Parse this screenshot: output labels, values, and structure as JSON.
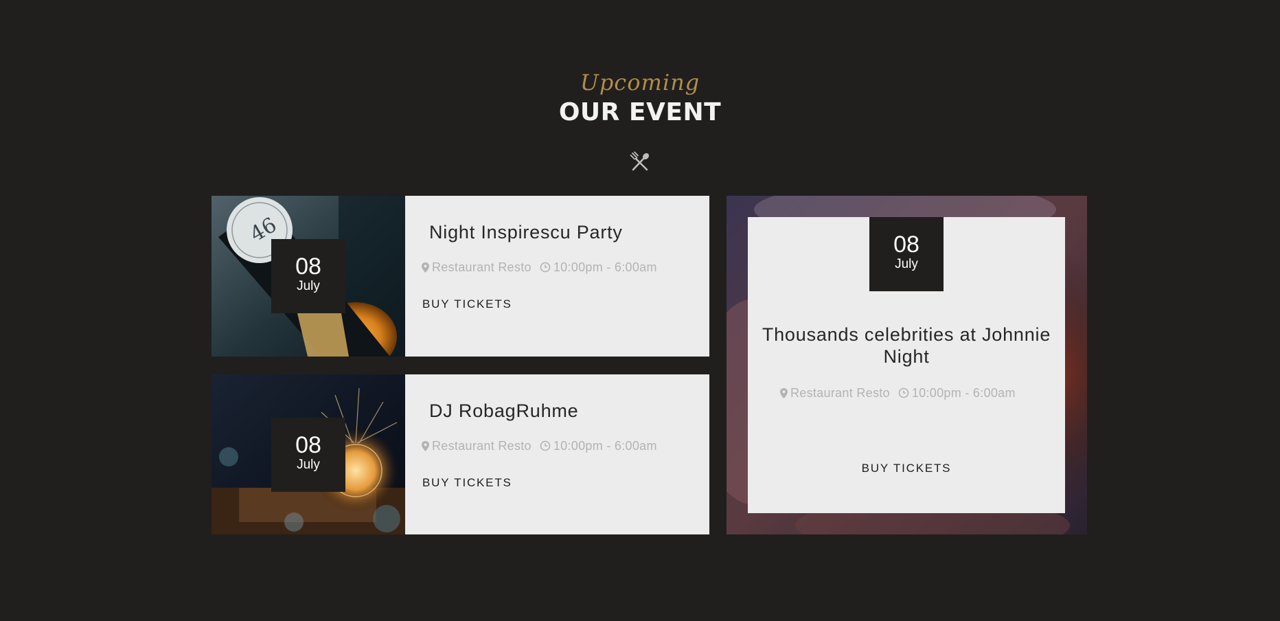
{
  "header": {
    "subtitle": "Upcoming",
    "title": "OUR EVENT",
    "icon": "fork-spoon-icon"
  },
  "colors": {
    "background": "#201f1d",
    "accent": "#b08d4b",
    "card": "#ececec",
    "date_box": "#201f1d",
    "meta_text": "#b3b3b3"
  },
  "events": [
    {
      "day": "08",
      "month": "July",
      "title": "Night Inspirescu Party",
      "location": "Restaurant Resto",
      "time": "10:00pm - 6:00am",
      "cta": "BUY TICKETS"
    },
    {
      "day": "08",
      "month": "July",
      "title": "DJ RobagRuhme",
      "location": "Restaurant Resto",
      "time": "10:00pm - 6:00am",
      "cta": "BUY TICKETS"
    },
    {
      "day": "08",
      "month": "July",
      "title": "Thousands celebrities at Johnnie Night",
      "location": "Restaurant Resto",
      "time": "10:00pm - 6:00am",
      "cta": "BUY TICKETS"
    }
  ]
}
